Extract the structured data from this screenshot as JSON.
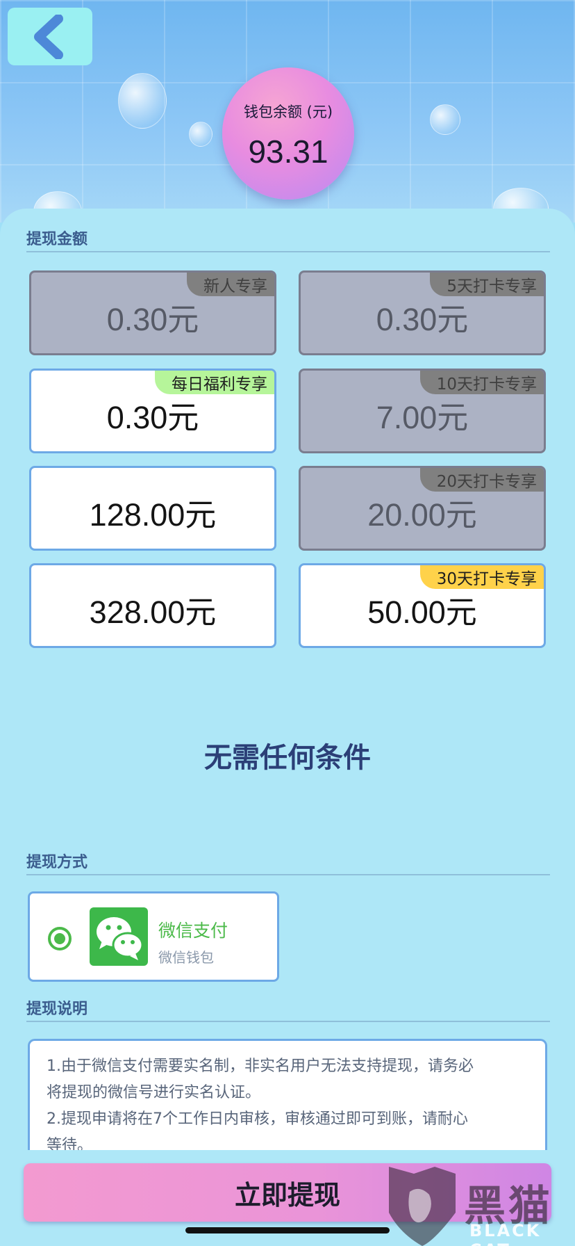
{
  "header": {
    "balance_label": "钱包余额 (元)",
    "balance_value": "93.31"
  },
  "withdraw_amount": {
    "title": "提现金额",
    "options": [
      {
        "amount": "0.30元",
        "tag": "新人专享",
        "state": "disabled"
      },
      {
        "amount": "0.30元",
        "tag": "5天打卡专享",
        "state": "disabled"
      },
      {
        "amount": "0.30元",
        "tag": "每日福利专享",
        "state": "available"
      },
      {
        "amount": "7.00元",
        "tag": "10天打卡专享",
        "state": "disabled"
      },
      {
        "amount": "128.00元",
        "tag": "",
        "state": "available"
      },
      {
        "amount": "20.00元",
        "tag": "20天打卡专享",
        "state": "disabled"
      },
      {
        "amount": "328.00元",
        "tag": "",
        "state": "available"
      },
      {
        "amount": "50.00元",
        "tag": "30天打卡专享",
        "state": "available"
      }
    ],
    "condition_text": "无需任何条件"
  },
  "withdraw_method": {
    "title": "提现方式",
    "method_name": "微信支付",
    "method_sub": "微信钱包",
    "selected": true
  },
  "withdraw_notes": {
    "title": "提现说明",
    "lines": [
      "1.由于微信支付需要实名制，非实名用户无法支持提现，请务必",
      "将提现的微信号进行实名认证。",
      "2.提现申请将在7个工作日内审核，审核通过即可到账，请耐心",
      "等待。"
    ]
  },
  "submit_label": "立即提现",
  "watermark": {
    "cn": "黑猫",
    "en": "BLACK CAT"
  },
  "colors": {
    "accent_green": "#4cba4a",
    "card_border": "#6da9e6",
    "tag_green": "#b6f59a",
    "tag_yellow": "#ffd24a",
    "button_pink": "#ea94d8"
  }
}
